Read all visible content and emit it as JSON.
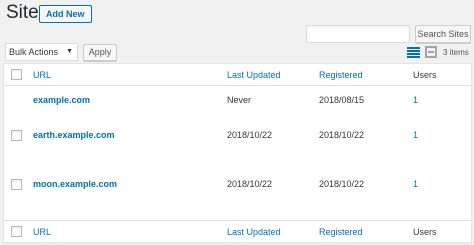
{
  "header": {
    "title": "Sites",
    "add_new_label": "Add New"
  },
  "search": {
    "value": "",
    "placeholder": "",
    "button_label": "Search Sites"
  },
  "bulk_actions": {
    "selected": "Bulk Actions",
    "apply_label": "Apply"
  },
  "view_modes": [
    "list-view",
    "excerpt-view"
  ],
  "item_count": "3 items",
  "columns": {
    "url": "URL",
    "last_updated": "Last Updated",
    "registered": "Registered",
    "users": "Users"
  },
  "rows": [
    {
      "url": "example.com",
      "last_updated": "Never",
      "registered": "2018/08/15",
      "users": "1"
    },
    {
      "url": "earth.example.com",
      "last_updated": "2018/10/22",
      "registered": "2018/10/22",
      "users": "1"
    },
    {
      "url": "moon.example.com",
      "last_updated": "2018/10/22",
      "registered": "2018/10/22",
      "users": "1"
    }
  ],
  "colors": {
    "link": "#0073aa",
    "background": "#f1f1f1",
    "text": "#23282d"
  }
}
